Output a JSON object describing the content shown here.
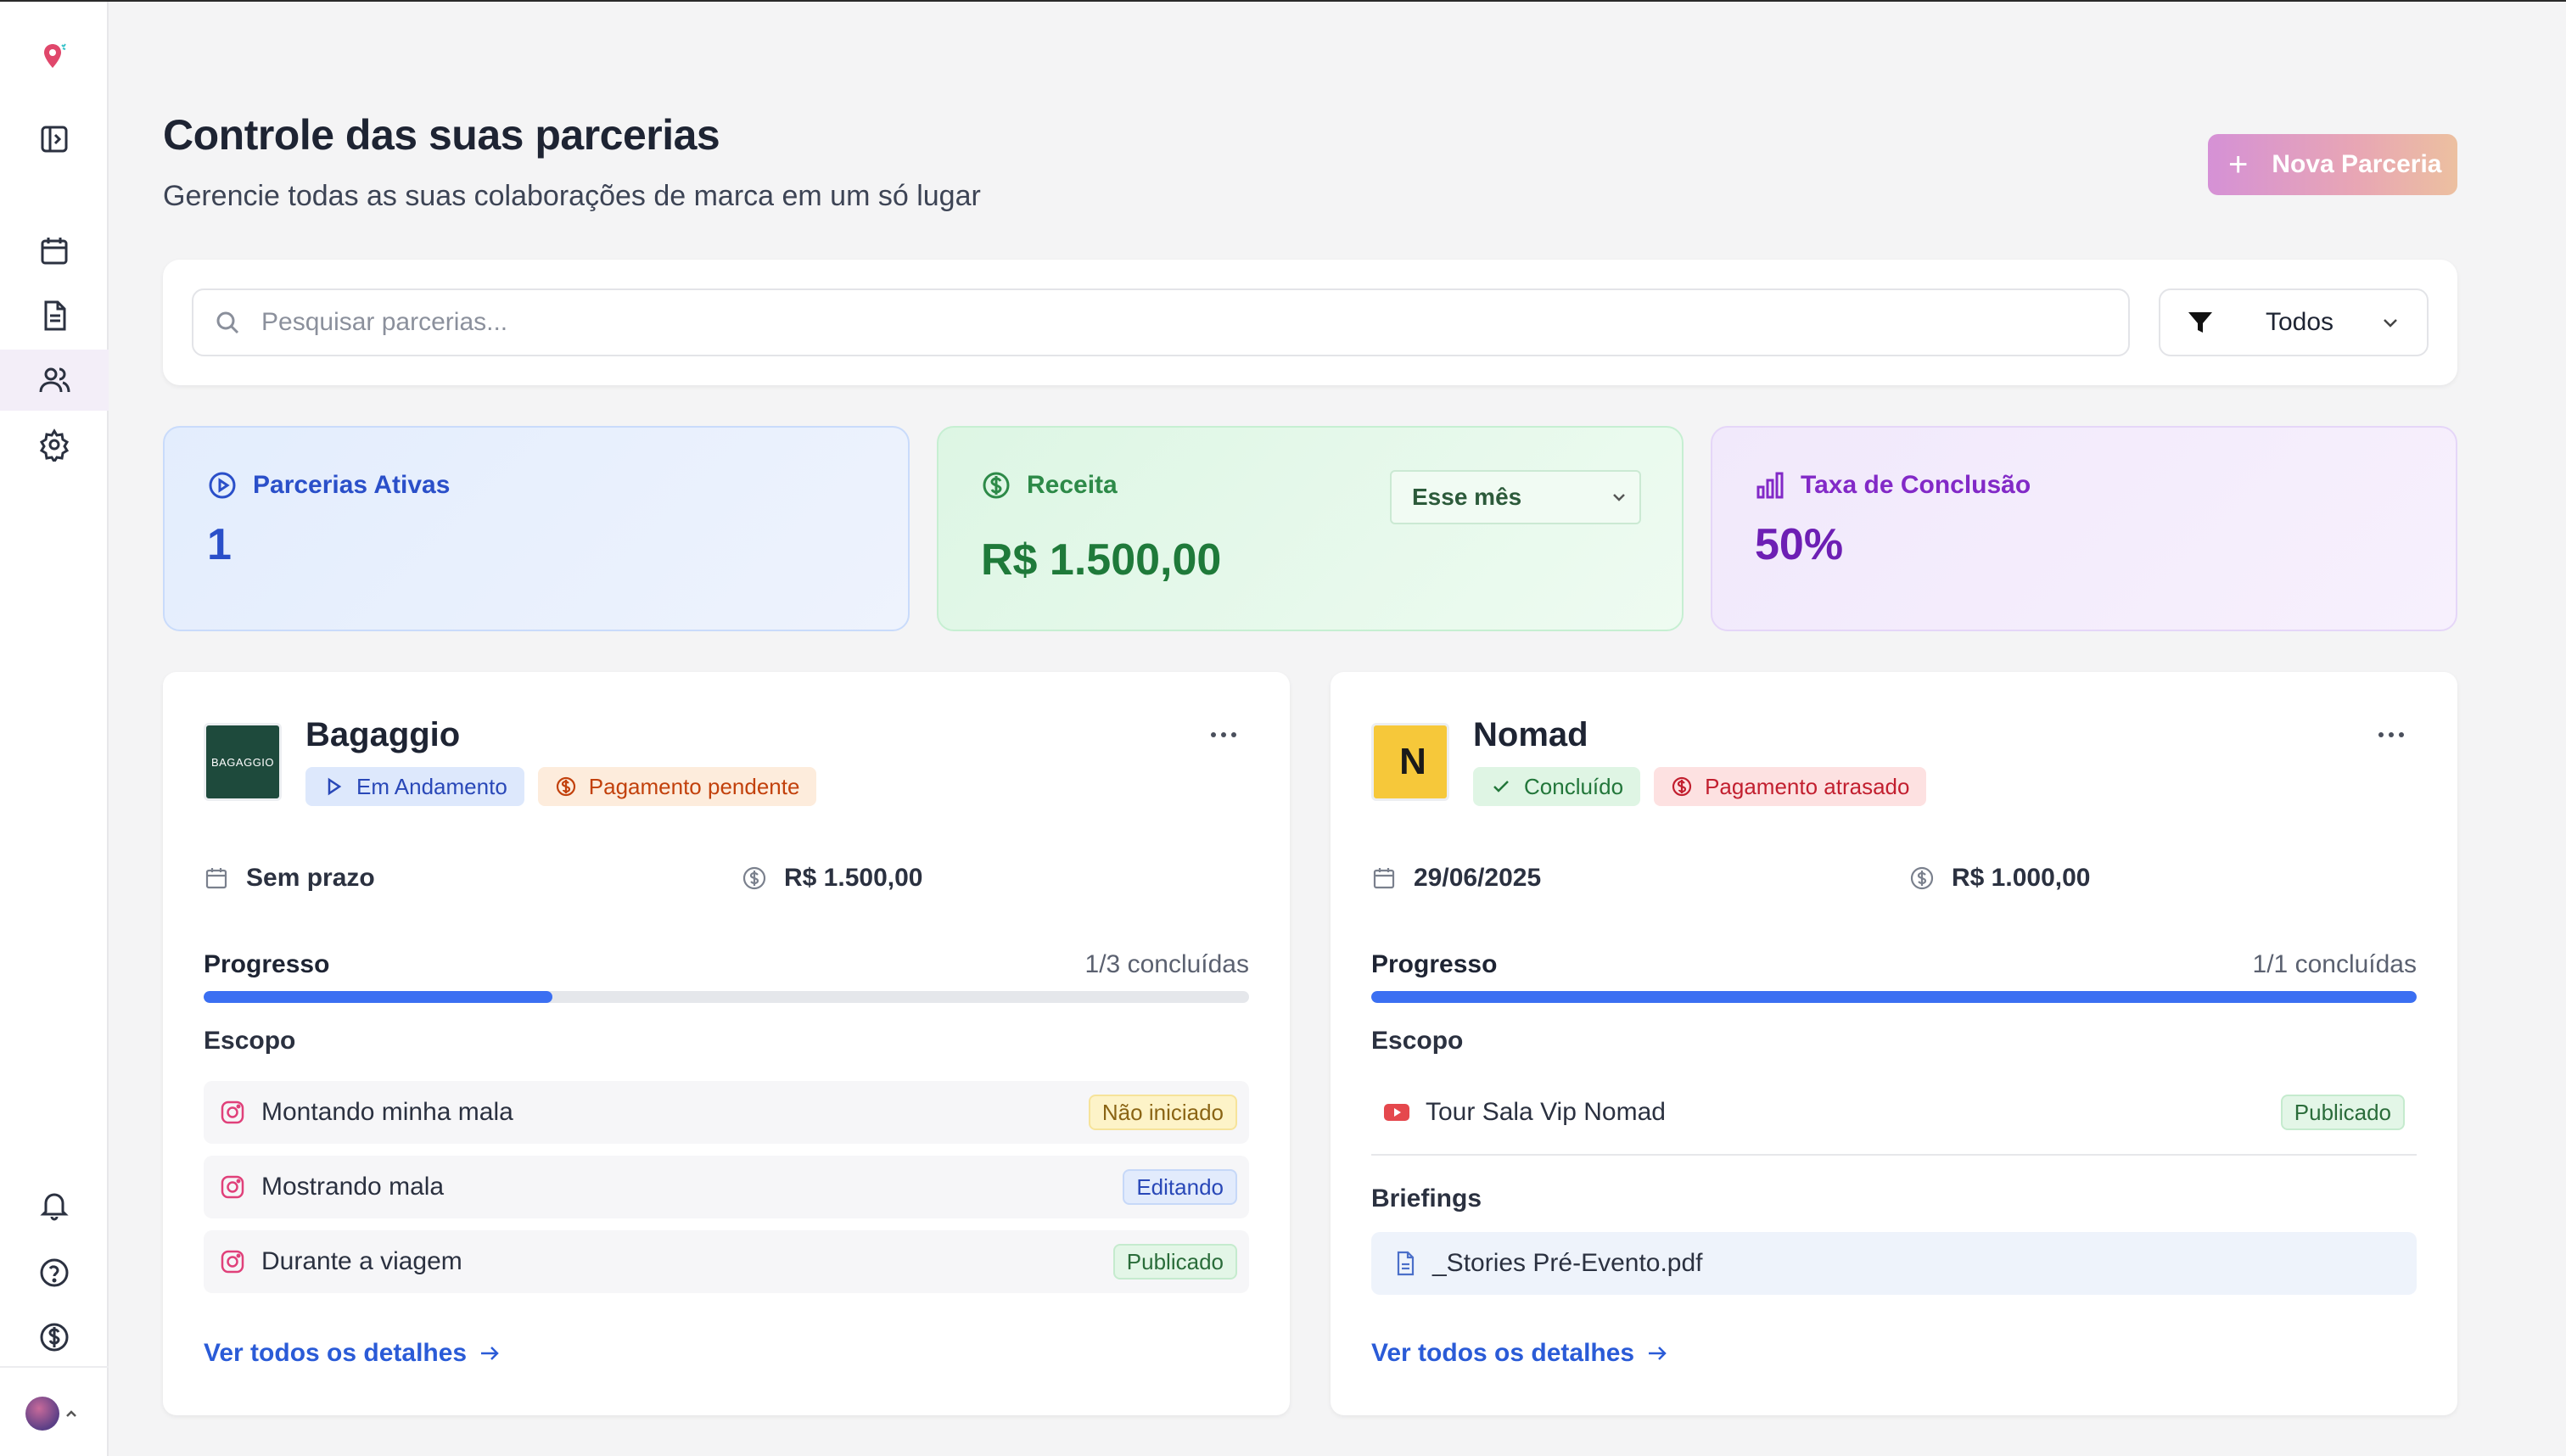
{
  "header": {
    "title": "Controle das suas parcerias",
    "subtitle": "Gerencie todas as suas colaborações de marca em um só lugar",
    "new_button_label": "Nova Parceria"
  },
  "search": {
    "placeholder": "Pesquisar parcerias...",
    "value": "",
    "filter_value": "Todos"
  },
  "stats": {
    "active": {
      "label": "Parcerias Ativas",
      "value": "1"
    },
    "revenue": {
      "label": "Receita",
      "value": "R$ 1.500,00",
      "period": "Esse mês"
    },
    "completion": {
      "label": "Taxa de Conclusão",
      "value": "50%"
    }
  },
  "partners": [
    {
      "name": "Bagaggio",
      "logo_text": "BAGAGGIO",
      "status": "Em Andamento",
      "payment": "Pagamento pendente",
      "deadline": "Sem prazo",
      "amount": "R$ 1.500,00",
      "progress_label": "Progresso",
      "progress_count": "1/3 concluídas",
      "progress_fraction": 0.3333,
      "scope_title": "Escopo",
      "scope": [
        {
          "title": "Montando minha mala",
          "status": "Não iniciado",
          "icon": "instagram-icon"
        },
        {
          "title": "Mostrando mala",
          "status": "Editando",
          "icon": "instagram-icon"
        },
        {
          "title": "Durante a viagem",
          "status": "Publicado",
          "icon": "instagram-icon"
        }
      ],
      "details_link": "Ver todos os detalhes"
    },
    {
      "name": "Nomad",
      "logo_text": "N",
      "status": "Concluído",
      "payment": "Pagamento atrasado",
      "deadline": "29/06/2025",
      "amount": "R$ 1.000,00",
      "progress_label": "Progresso",
      "progress_count": "1/1 concluídas",
      "progress_fraction": 1.0,
      "scope_title": "Escopo",
      "scope": [
        {
          "title": "Tour Sala Vip Nomad",
          "status": "Publicado",
          "icon": "youtube-icon"
        }
      ],
      "briefings_title": "Briefings",
      "briefings": [
        {
          "file": "_Stories Pré-Evento.pdf"
        }
      ],
      "details_link": "Ver todos os detalhes"
    }
  ],
  "colors": {
    "accent_blue": "#3b6ff2",
    "brand_gradient_start": "#d591d6",
    "brand_gradient_end": "#ecc0a0"
  }
}
